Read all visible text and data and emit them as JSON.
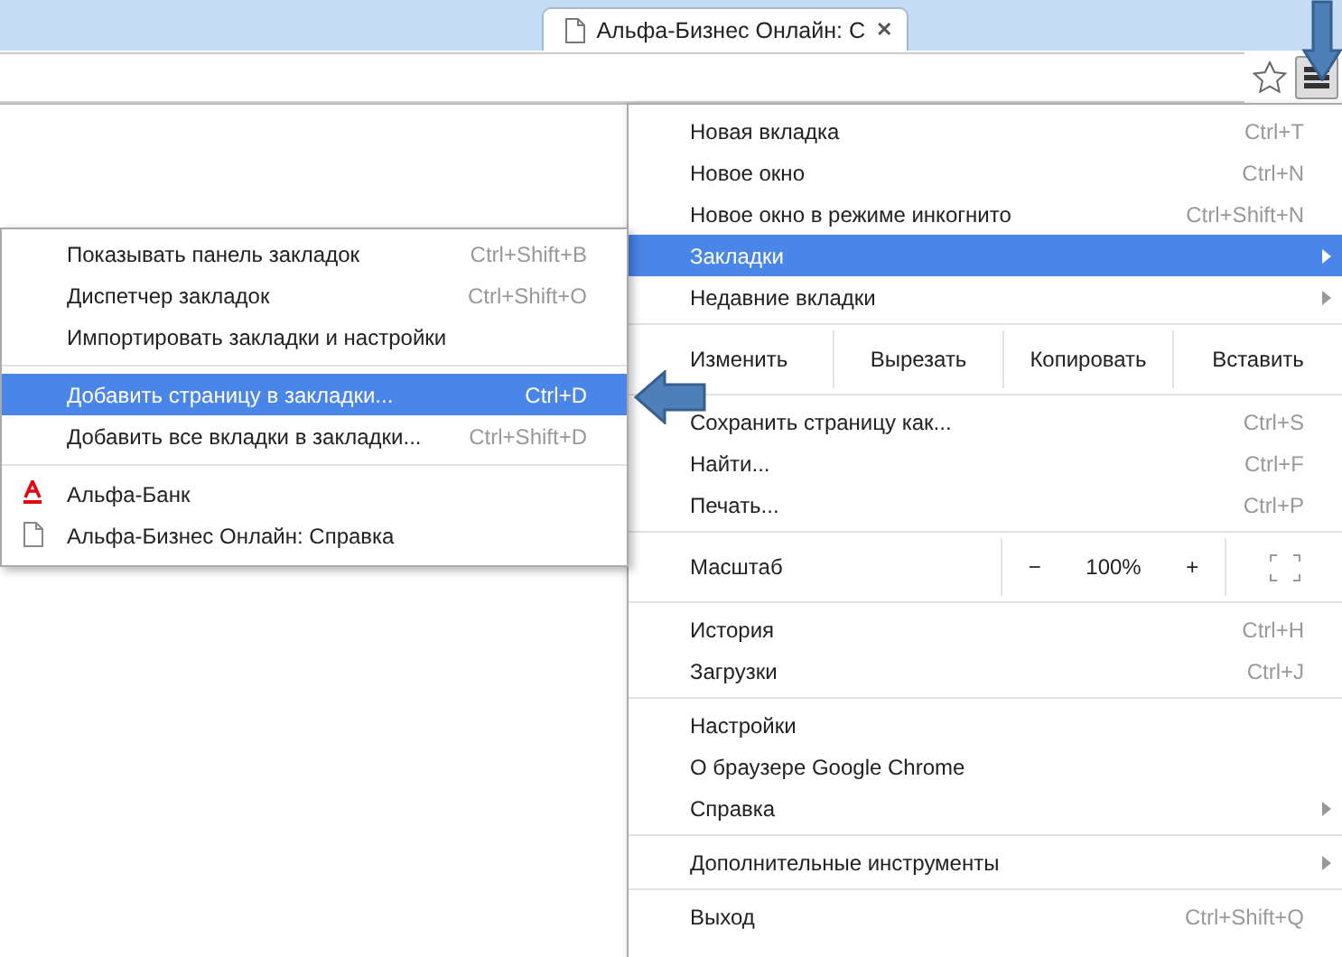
{
  "tab": {
    "title": "Альфа-Бизнес Онлайн: С",
    "close": "✕"
  },
  "menu": {
    "items": [
      {
        "kind": "item",
        "label": "Новая вкладка",
        "shortcut": "Ctrl+T",
        "selected": false
      },
      {
        "kind": "item",
        "label": "Новое окно",
        "shortcut": "Ctrl+N",
        "selected": false
      },
      {
        "kind": "item",
        "label": "Новое окно в режиме инкогнито",
        "shortcut": "Ctrl+Shift+N",
        "selected": false
      },
      {
        "kind": "submenu",
        "label": "Закладки",
        "selected": true
      },
      {
        "kind": "submenu",
        "label": "Недавние вкладки",
        "selected": false
      },
      {
        "kind": "separator"
      },
      {
        "kind": "edit_row",
        "label": "Изменить",
        "buttons": [
          "Вырезать",
          "Копировать",
          "Вставить"
        ]
      },
      {
        "kind": "separator"
      },
      {
        "kind": "item",
        "label": "Сохранить страницу как...",
        "shortcut": "Ctrl+S",
        "selected": false
      },
      {
        "kind": "item",
        "label": "Найти...",
        "shortcut": "Ctrl+F",
        "selected": false
      },
      {
        "kind": "item",
        "label": "Печать...",
        "shortcut": "Ctrl+P",
        "selected": false
      },
      {
        "kind": "separator"
      },
      {
        "kind": "zoom_row",
        "label": "Масштаб",
        "minus": "−",
        "value": "100%",
        "plus": "+"
      },
      {
        "kind": "separator"
      },
      {
        "kind": "item",
        "label": "История",
        "shortcut": "Ctrl+H",
        "selected": false
      },
      {
        "kind": "item",
        "label": "Загрузки",
        "shortcut": "Ctrl+J",
        "selected": false
      },
      {
        "kind": "separator"
      },
      {
        "kind": "item",
        "label": "Настройки",
        "selected": false
      },
      {
        "kind": "item",
        "label": "О браузере Google Chrome",
        "selected": false
      },
      {
        "kind": "submenu",
        "label": "Справка",
        "selected": false
      },
      {
        "kind": "separator"
      },
      {
        "kind": "submenu",
        "label": "Дополнительные инструменты",
        "selected": false
      },
      {
        "kind": "separator"
      },
      {
        "kind": "item",
        "label": "Выход",
        "shortcut": "Ctrl+Shift+Q",
        "selected": false
      }
    ]
  },
  "bookmarks_menu": {
    "items": [
      {
        "kind": "item",
        "label": "Показывать панель закладок",
        "shortcut": "Ctrl+Shift+B",
        "selected": false
      },
      {
        "kind": "item",
        "label": "Диспетчер закладок",
        "shortcut": "Ctrl+Shift+O",
        "selected": false
      },
      {
        "kind": "item",
        "label": "Импортировать закладки и настройки",
        "selected": false
      },
      {
        "kind": "separator"
      },
      {
        "kind": "item",
        "label": "Добавить страницу в закладки...",
        "shortcut": "Ctrl+D",
        "selected": true
      },
      {
        "kind": "item",
        "label": "Добавить все вкладки в закладки...",
        "shortcut": "Ctrl+Shift+D",
        "selected": false
      },
      {
        "kind": "separator"
      },
      {
        "kind": "logo_bookmark",
        "label": "Альфа-Банк",
        "selected": false
      },
      {
        "kind": "page_bookmark",
        "label": "Альфа-Бизнес Онлайн: Справка",
        "selected": false
      }
    ]
  }
}
